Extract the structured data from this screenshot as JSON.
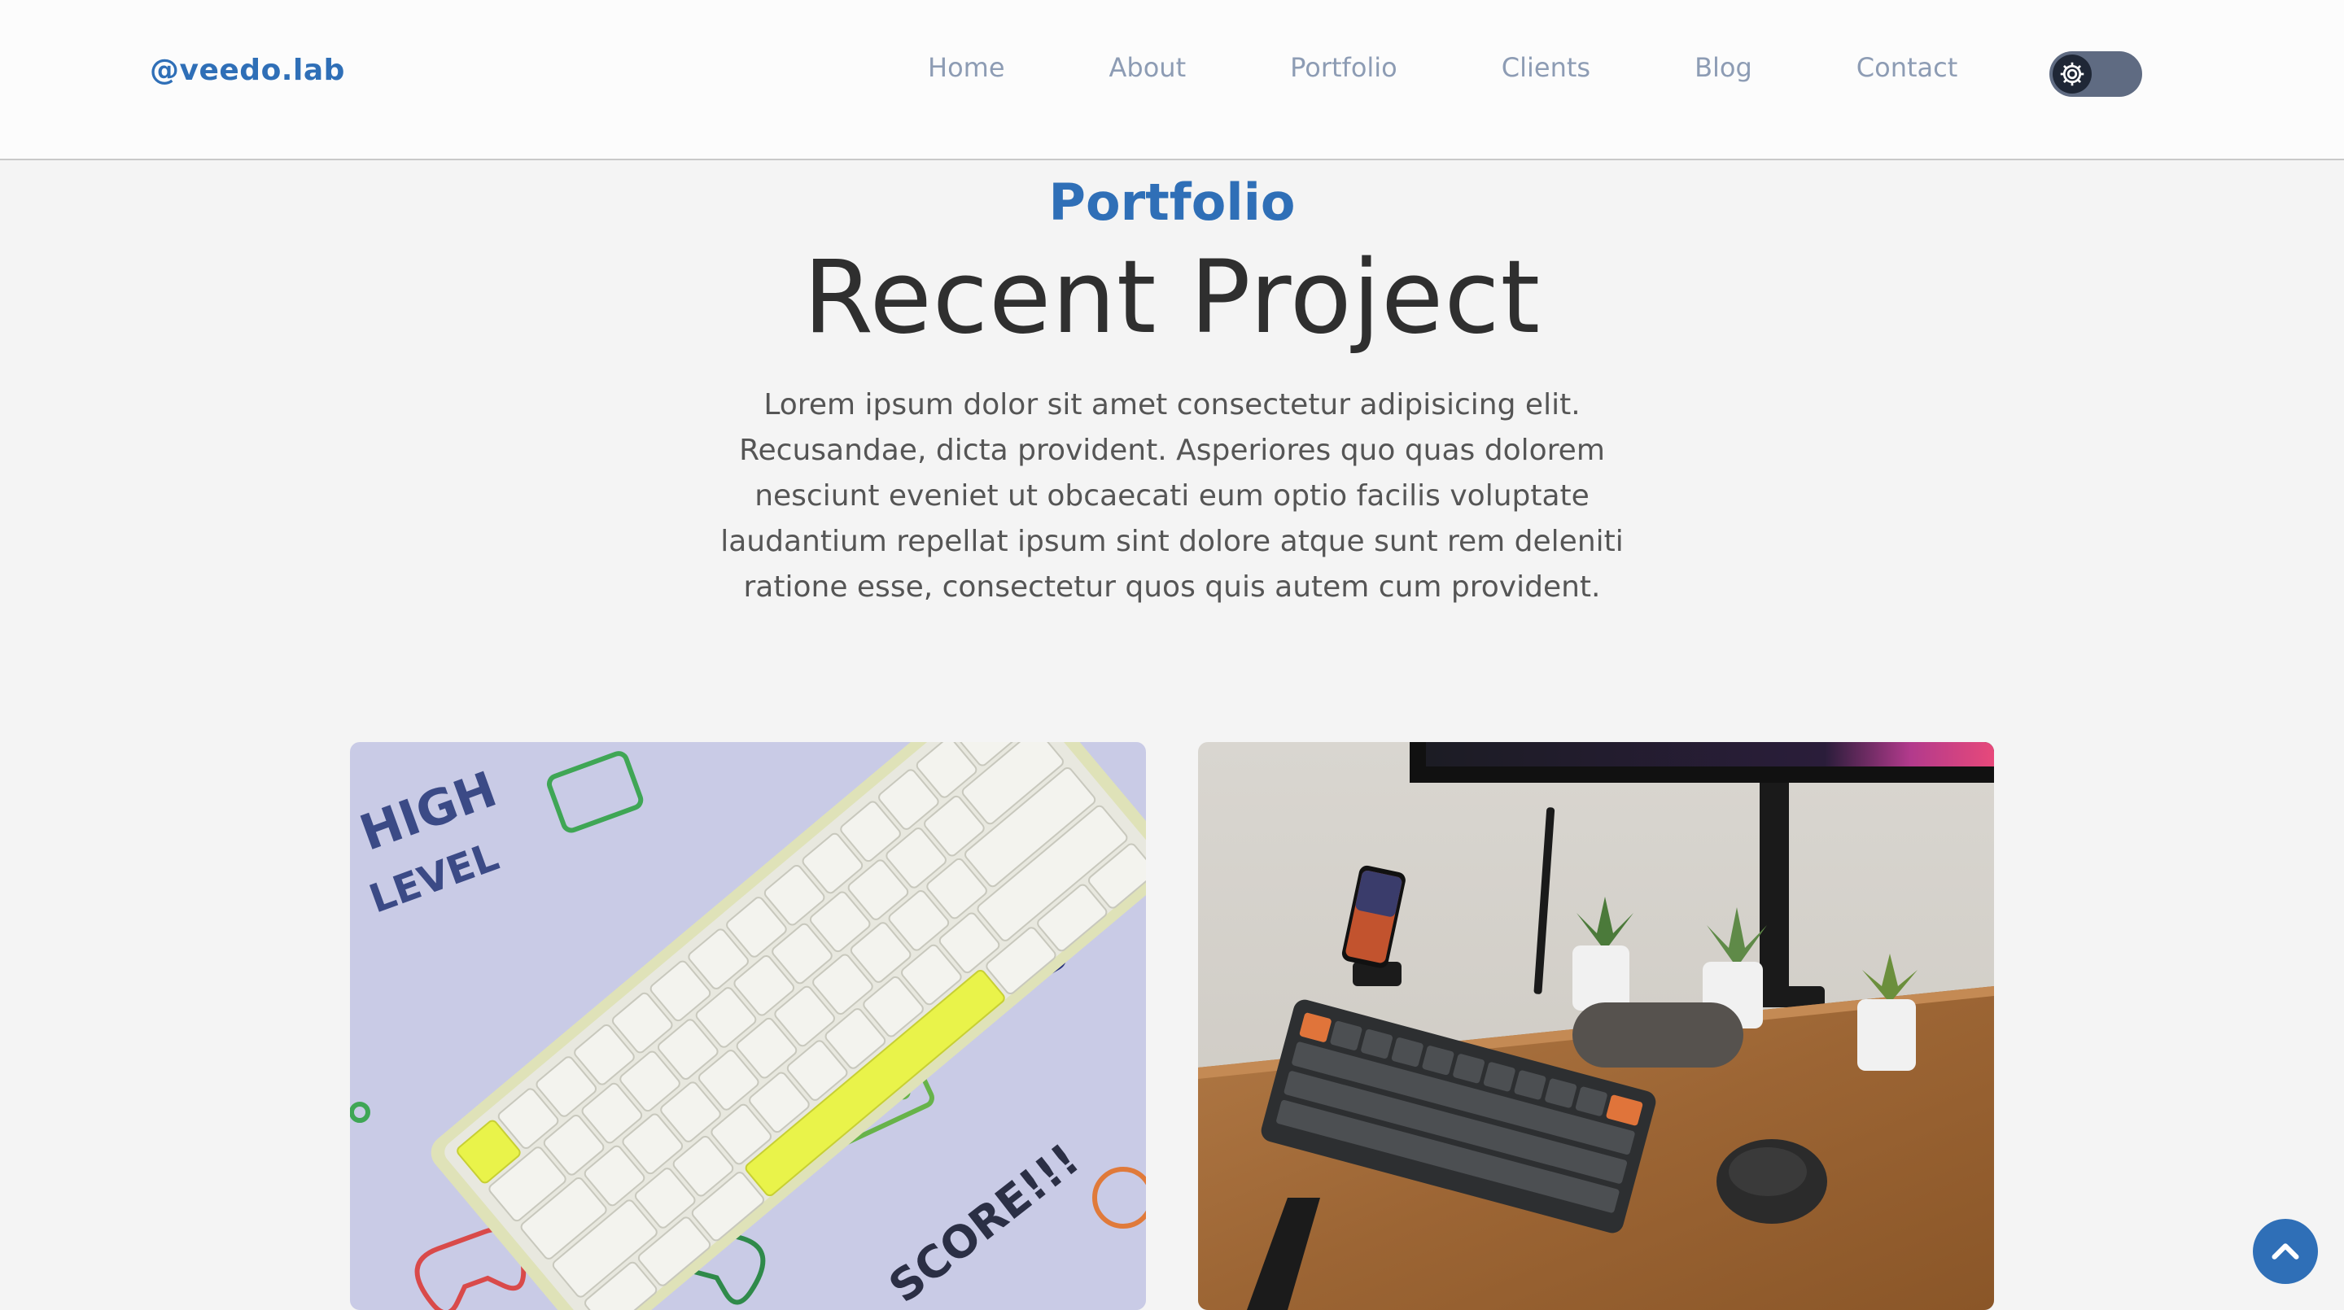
{
  "header": {
    "logo": "@veedo.lab",
    "nav": [
      "Home",
      "About",
      "Portfolio",
      "Clients",
      "Blog",
      "Contact"
    ]
  },
  "theme_toggle": {
    "icon": "gear-icon",
    "state": "dark"
  },
  "portfolio": {
    "tag": "Portfolio",
    "title": "Recent Project",
    "description": "Lorem ipsum dolor sit amet consectetur adipisicing elit. Recusandae, dicta provident. Asperiores quo quas dolorem nesciunt eveniet ut obcaecati eum optio facilis voluptate laudantium repellat ipsum sint dolore atque sunt rem deleniti ratione esse, consectetur quos quis autem cum provident.",
    "projects": [
      {
        "image": "keyboard-mousepad-photo",
        "mousepad_text_1": "HIGH",
        "mousepad_text_2": "LEVEL",
        "mousepad_text_3": "SCORE!!!"
      },
      {
        "image": "desk-setup-photo"
      }
    ]
  },
  "back_to_top": {
    "icon": "chevron-up-icon"
  },
  "colors": {
    "accent": "#2f6fb7",
    "nav_text": "#8d9cb4",
    "background": "#f4f4f4",
    "header_bg": "#fcfcfc"
  }
}
